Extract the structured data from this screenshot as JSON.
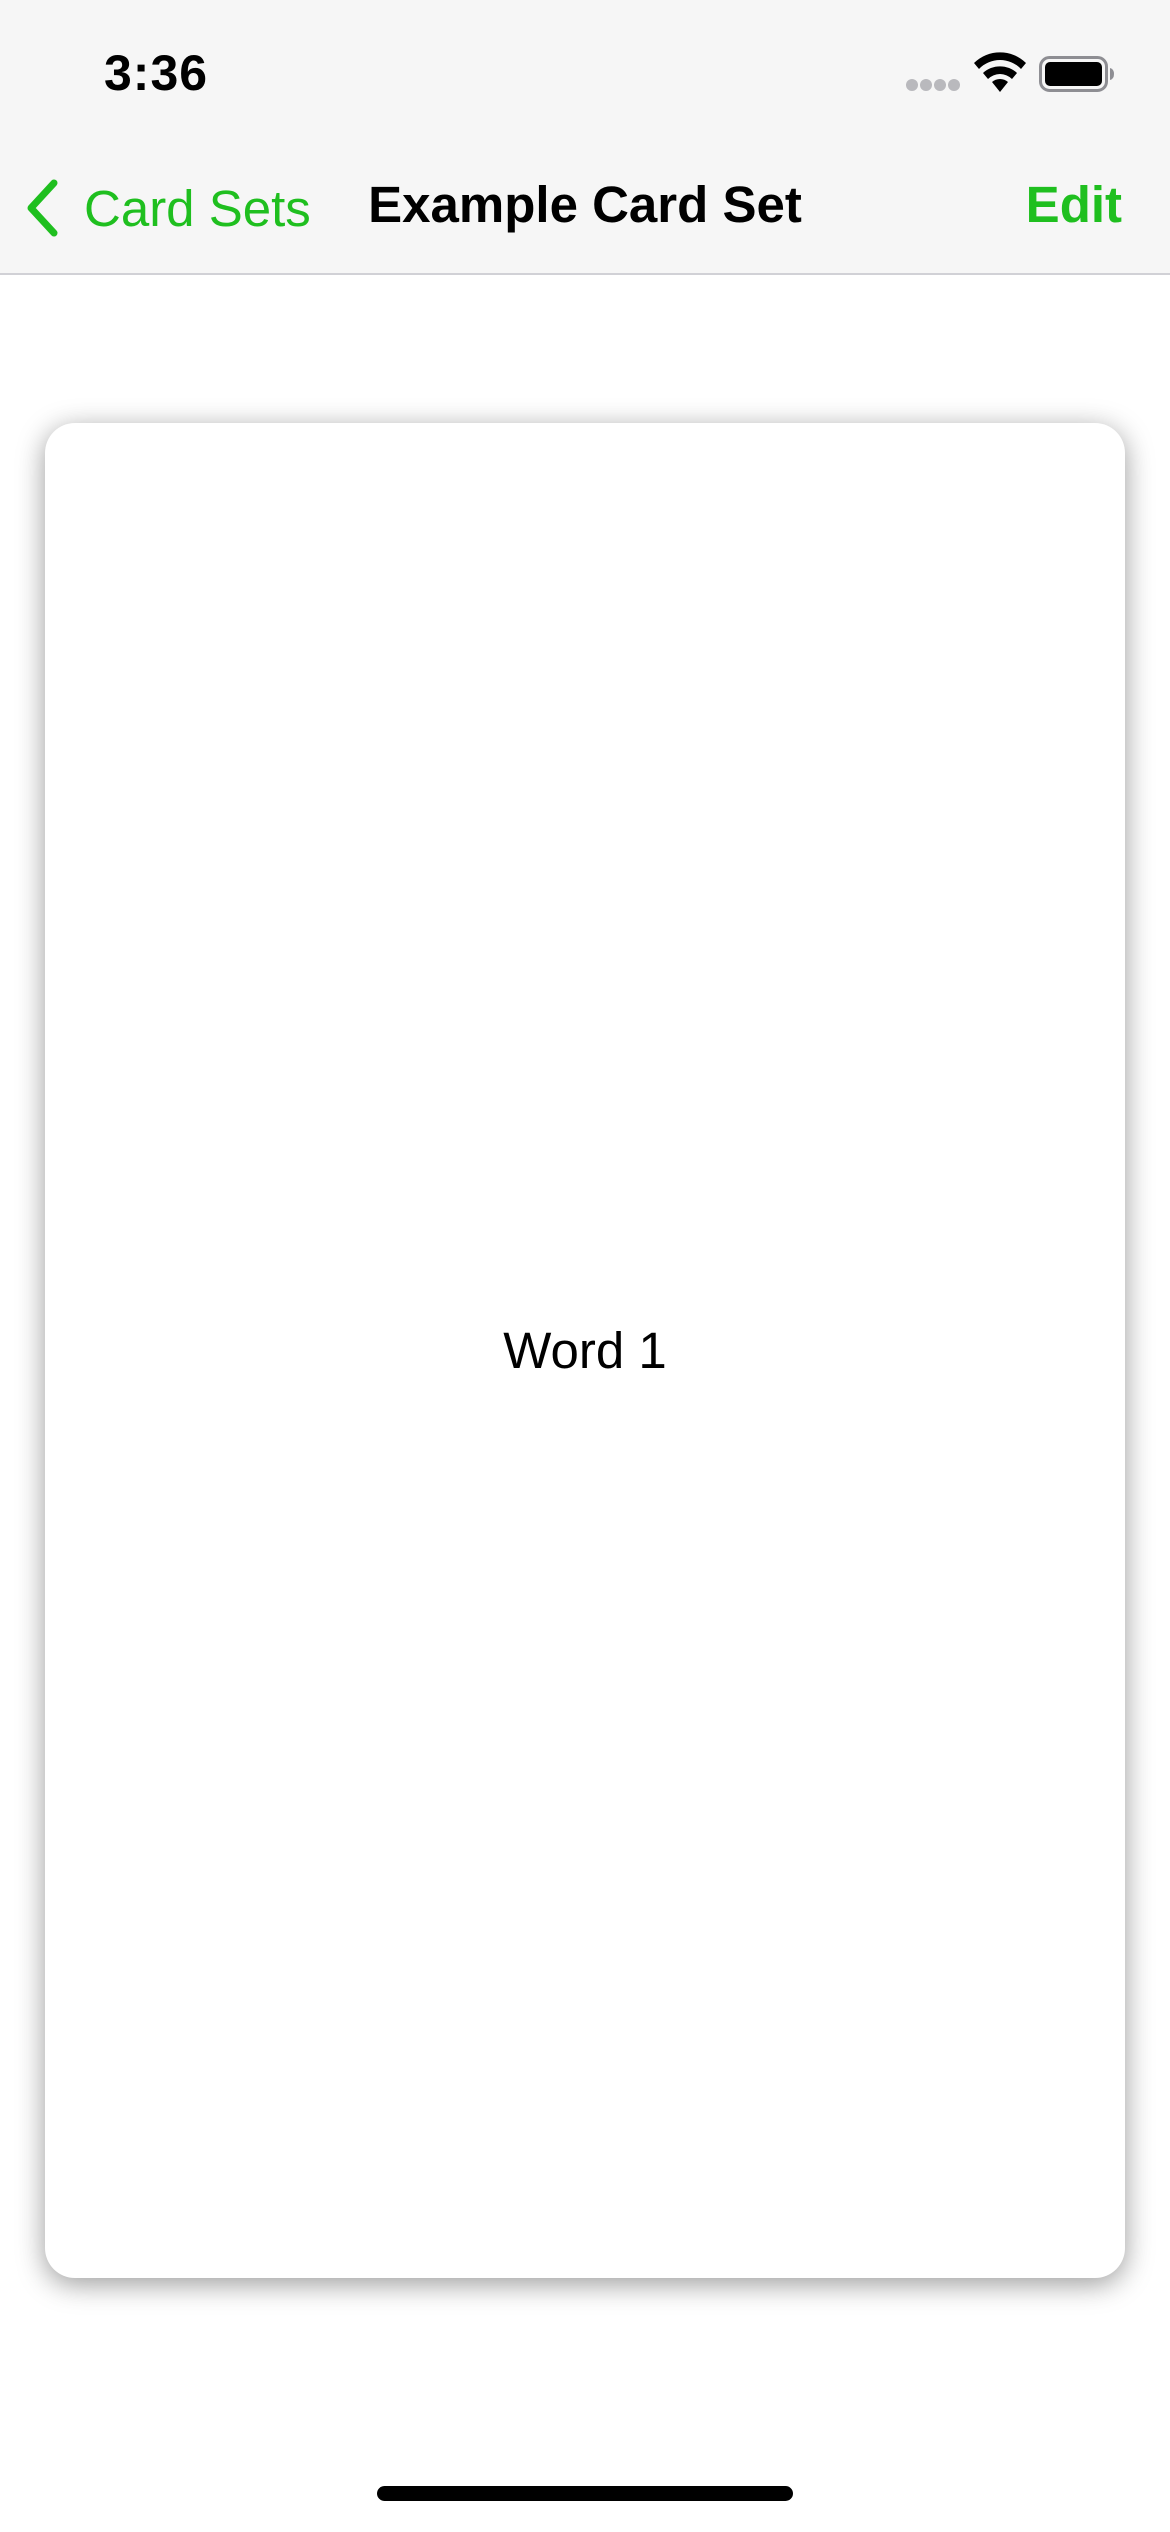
{
  "colors": {
    "accent": "#1fbf1f",
    "text": "#000000",
    "bar_background": "#f6f6f6"
  },
  "status_bar": {
    "time": "3:36",
    "icons": [
      "cellular-signal-icon",
      "wifi-icon",
      "battery-icon"
    ]
  },
  "nav_bar": {
    "back_label": "Card Sets",
    "back_icon": "chevron-left-icon",
    "title": "Example Card Set",
    "edit_label": "Edit"
  },
  "card": {
    "word": "Word 1"
  }
}
